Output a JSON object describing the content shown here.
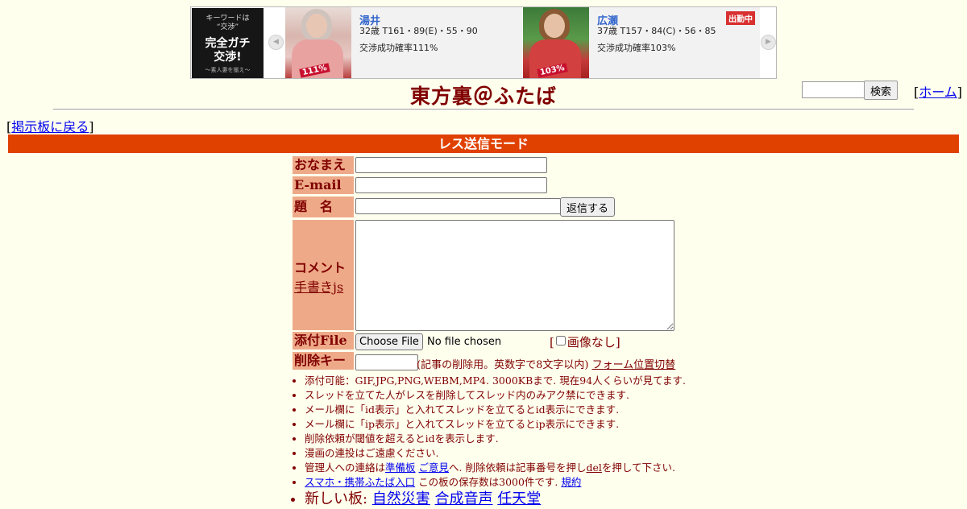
{
  "ad": {
    "logo": {
      "line1": "キーワードは",
      "line2": "“交渉”",
      "line3": "完全ガチ",
      "line4": "交渉!",
      "line5": "〜素人妻を揃え〜"
    },
    "cards": [
      {
        "name": "湯井",
        "stats": "32歳 T161・89(E)・55・90",
        "rate": "交渉成功確率111%",
        "badge": "111%",
        "status": ""
      },
      {
        "name": "広瀬",
        "stats": "37歳 T157・84(C)・56・85",
        "rate": "交渉成功確率103%",
        "badge": "103%",
        "status": "出勤中"
      }
    ],
    "prev_icon": "chevron-left-icon",
    "next_icon": "chevron-right-icon"
  },
  "header": {
    "title": "東方裏＠ふたば",
    "search_button": "検索",
    "home_link": "ホーム",
    "back_link": "掲示板に戻る"
  },
  "mode_bar": "レス送信モード",
  "form": {
    "labels": {
      "name": "おなまえ",
      "email": "E-mail",
      "subject": "題名",
      "comment": "コメント",
      "handwrite": "手書きjs",
      "file": "添付File",
      "delkey": "削除キー"
    },
    "values": {
      "name": "",
      "email": "",
      "subject": "",
      "comment": "",
      "delkey": ""
    },
    "reply_button": "返信する",
    "choose_file_button": "Choose File",
    "no_file_text": "No file chosen",
    "no_image_label": "画像なし",
    "delkey_note": "(記事の削除用。英数字で8文字以内)",
    "form_position_link": "フォーム位置切替"
  },
  "notes": {
    "n1": "添付可能：GIF,JPG,PNG,WEBM,MP4. 3000KBまで. 現在94人くらいが見てます.",
    "n2": "スレッドを立てた人がレスを削除してスレッド内のみアク禁にできます.",
    "n3": "メール欄に「id表示」と入れてスレッドを立てるとid表示にできます.",
    "n4": "メール欄に「ip表示」と入れてスレッドを立てるとip表示にできます.",
    "n5": "削除依頼が閾値を超えるとidを表示します.",
    "n6": "漫画の連投はご遠慮ください.",
    "n7_pre": "管理人への連絡は",
    "n7_link1": "準備板",
    "n7_link2": "ご意見",
    "n7_mid": "へ. 削除依頼は記事番号を押し",
    "n7_link3": "del",
    "n7_post": "を押して下さい.",
    "n8_link1": "スマホ・携帯ふたば入口",
    "n8_mid": " この板の保存数は3000件です.",
    "n8_link2": "規約",
    "n9_pre": "新しい板:",
    "n9_link1": "自然災害",
    "n9_link2": "合成音声",
    "n9_link3": "任天堂"
  },
  "colors": {
    "background": "#ffffee",
    "text": "#800000",
    "mode_bar": "#e04000",
    "label_cell": "#eeaa88",
    "link": "#0000ee"
  }
}
